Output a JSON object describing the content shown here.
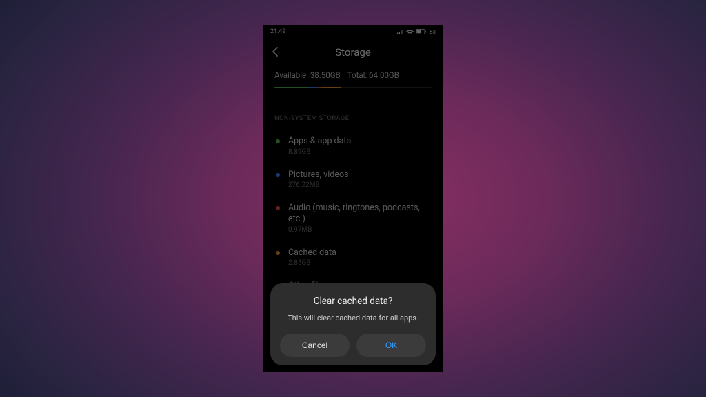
{
  "statusbar": {
    "time": "21:49",
    "battery_text": "53"
  },
  "header": {
    "title": "Storage"
  },
  "summary": {
    "available_label": "Available:",
    "available_value": "38.50GB",
    "total_label": "Total:",
    "total_value": "64.00GB"
  },
  "section_header": "NON-SYSTEM STORAGE",
  "items": [
    {
      "title": "Apps & app data",
      "sub": "8.89GB",
      "color": "green"
    },
    {
      "title": "Pictures, videos",
      "sub": "276.22MB",
      "color": "blue"
    },
    {
      "title": "Audio (music, ringtones, podcasts, etc.)",
      "sub": "0.97MB",
      "color": "red"
    },
    {
      "title": "Cached data",
      "sub": "2.85GB",
      "color": "orange"
    },
    {
      "title": "Other files",
      "sub": "",
      "color": "grey"
    }
  ],
  "dialog": {
    "title": "Clear cached data?",
    "message": "This will clear cached data for all apps.",
    "cancel": "Cancel",
    "ok": "OK"
  }
}
